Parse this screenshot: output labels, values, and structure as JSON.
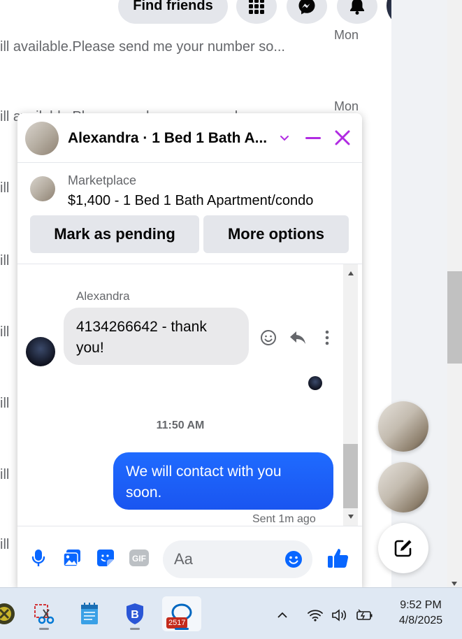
{
  "header": {
    "find_friends_label": "Find friends",
    "icons": [
      "menu-grid-icon",
      "messenger-icon",
      "notifications-bell-icon",
      "profile-avatar"
    ]
  },
  "background_list": {
    "rows": [
      {
        "text": "ill available.Please send me your number so...",
        "time": "Mon"
      },
      {
        "text": "ill available.Please send me your number so...",
        "time": "Mon"
      },
      {
        "text": "ill",
        "time": ""
      },
      {
        "text": "ill",
        "time": ""
      },
      {
        "text": "ill",
        "time": ""
      },
      {
        "text": "ill",
        "time": ""
      },
      {
        "text": "ill",
        "time": ""
      },
      {
        "text": "ill",
        "time": ""
      }
    ]
  },
  "chat": {
    "title": "Alexandra · 1 Bed 1 Bath A...",
    "marketplace": {
      "label": "Marketplace",
      "listing": "$1,400 - 1 Bed 1 Bath Apartment/condo",
      "mark_pending_label": "Mark as pending",
      "more_options_label": "More options"
    },
    "messages": {
      "sender_name": "Alexandra",
      "incoming_text": "4134266642 - thank you!",
      "time_separator": "11:50 AM",
      "outgoing_text": "We will contact with you soon.",
      "sent_status": "Sent 1m ago"
    },
    "composer": {
      "placeholder": "Aa",
      "icons": [
        "microphone-icon",
        "photo-icon",
        "sticker-icon",
        "gif-icon",
        "emoji-icon",
        "thumbs-up-icon"
      ]
    }
  },
  "taskbar": {
    "badge_count": "2517",
    "time": "9:52 PM",
    "date": "4/8/2025"
  },
  "colors": {
    "accent_purple": "#b02be2",
    "messenger_blue": "#0866ff",
    "outgoing_bubble": "#1a5ef5"
  }
}
